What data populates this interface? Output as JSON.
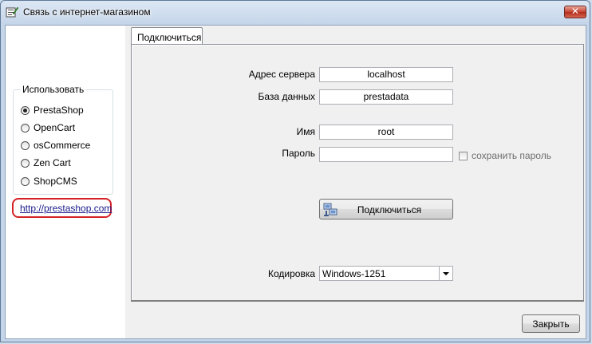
{
  "window": {
    "title": "Связь с интернет-магазином",
    "close_glyph": "✕"
  },
  "left": {
    "group_title": "Использовать",
    "options": [
      {
        "label": "PrestaShop",
        "checked": true
      },
      {
        "label": "OpenCart",
        "checked": false
      },
      {
        "label": "osCommerce",
        "checked": false
      },
      {
        "label": "Zen Cart",
        "checked": false
      },
      {
        "label": "ShopCMS",
        "checked": false
      }
    ],
    "link": "http://prestashop.com",
    "highlight_color": "#d42226"
  },
  "tabs": [
    {
      "label": "Подключиться",
      "active": true
    }
  ],
  "form": {
    "server_label": "Адрес сервера",
    "server_value": "localhost",
    "db_label": "База данных",
    "db_value": "prestadata",
    "name_label": "Имя",
    "name_value": "root",
    "password_label": "Пароль",
    "password_value": "",
    "save_password_label": "сохранить пароль",
    "save_password_checked": false,
    "connect_button": "Подключиться",
    "encoding_label": "Кодировка",
    "encoding_value": "Windows-1251"
  },
  "footer": {
    "close_button": "Закрыть"
  },
  "icons": [
    "window-app-icon",
    "close-icon",
    "connect-icon",
    "dropdown-arrow-icon"
  ]
}
